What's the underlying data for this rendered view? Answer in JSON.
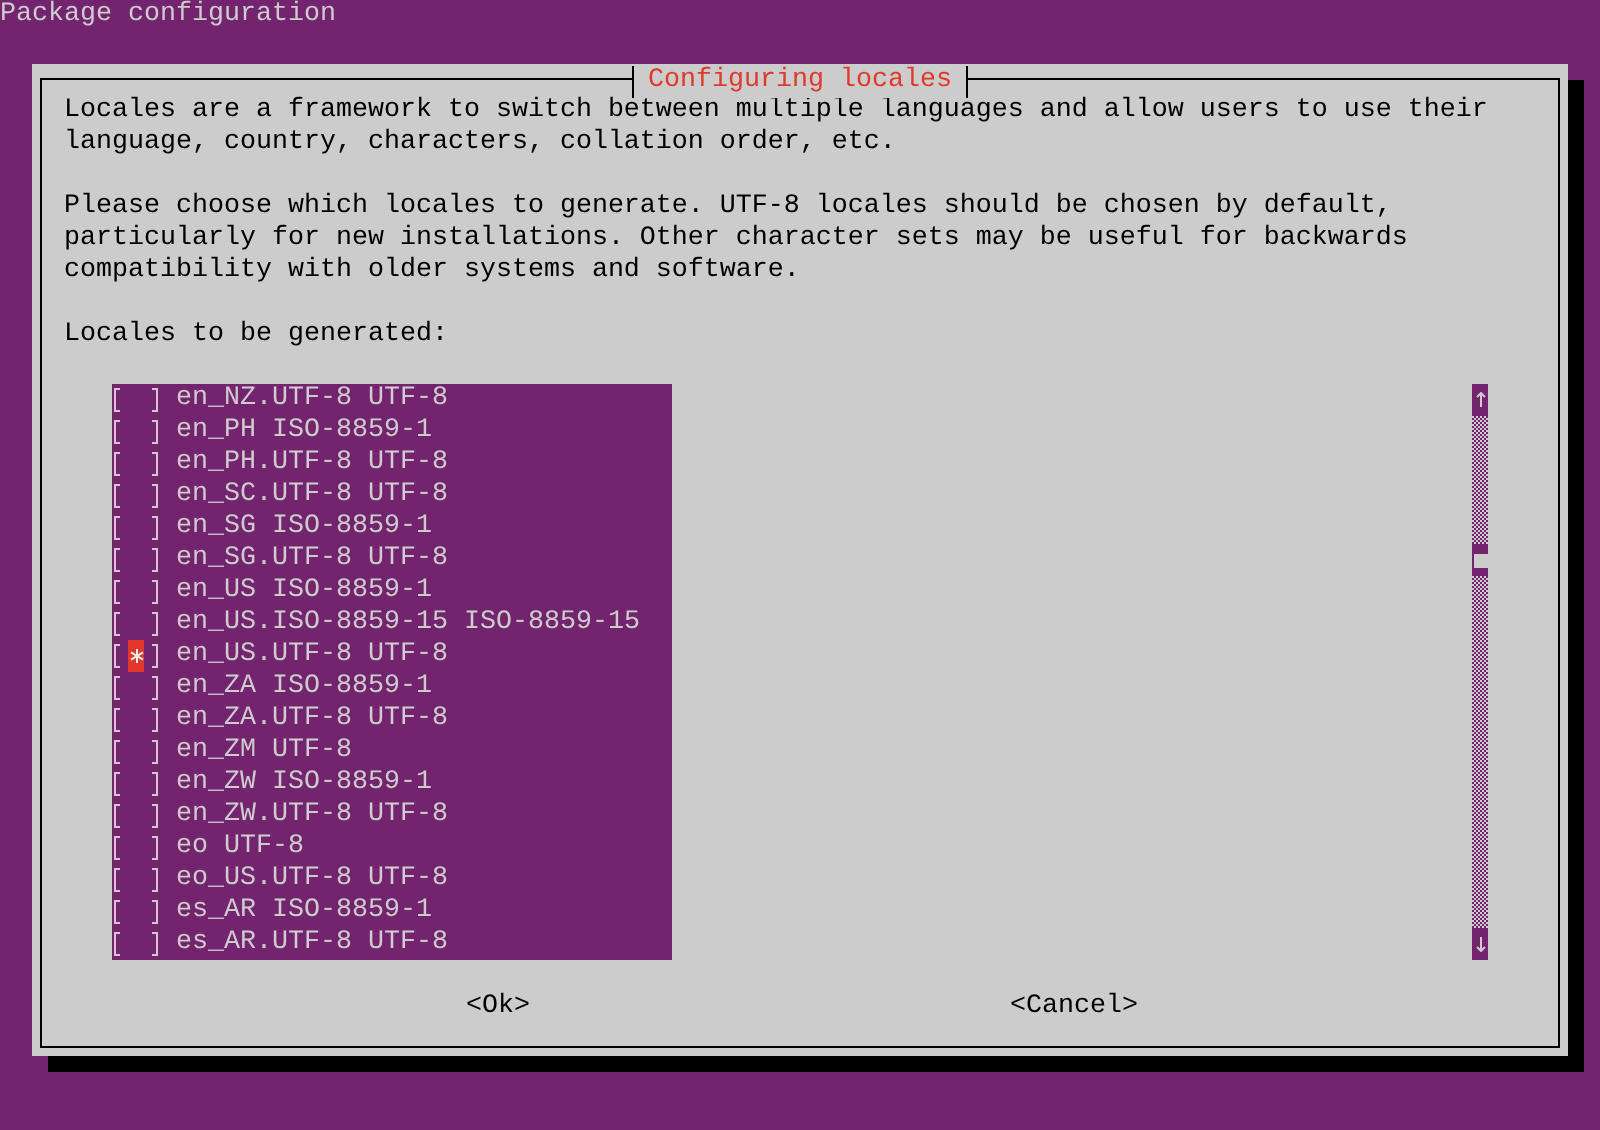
{
  "window": {
    "title": "Package configuration"
  },
  "dialog": {
    "title": "Configuring locales",
    "paragraphs": [
      "Locales are a framework to switch between multiple languages and allow users to use their language, country, characters, collation order, etc.",
      "Please choose which locales to generate. UTF-8 locales should be chosen by default, particularly for new installations. Other character sets may be useful for backwards compatibility with older systems and software."
    ],
    "list_label": "Locales to be generated:",
    "items": [
      {
        "label": "en_NZ.UTF-8 UTF-8",
        "checked": false,
        "selected": false
      },
      {
        "label": "en_PH ISO-8859-1",
        "checked": false,
        "selected": false
      },
      {
        "label": "en_PH.UTF-8 UTF-8",
        "checked": false,
        "selected": false
      },
      {
        "label": "en_SC.UTF-8 UTF-8",
        "checked": false,
        "selected": false
      },
      {
        "label": "en_SG ISO-8859-1",
        "checked": false,
        "selected": false
      },
      {
        "label": "en_SG.UTF-8 UTF-8",
        "checked": false,
        "selected": false
      },
      {
        "label": "en_US ISO-8859-1",
        "checked": false,
        "selected": false
      },
      {
        "label": "en_US.ISO-8859-15 ISO-8859-15",
        "checked": false,
        "selected": false
      },
      {
        "label": "en_US.UTF-8 UTF-8",
        "checked": true,
        "selected": true
      },
      {
        "label": "en_ZA ISO-8859-1",
        "checked": false,
        "selected": false
      },
      {
        "label": "en_ZA.UTF-8 UTF-8",
        "checked": false,
        "selected": false
      },
      {
        "label": "en_ZM UTF-8",
        "checked": false,
        "selected": false
      },
      {
        "label": "en_ZW ISO-8859-1",
        "checked": false,
        "selected": false
      },
      {
        "label": "en_ZW.UTF-8 UTF-8",
        "checked": false,
        "selected": false
      },
      {
        "label": "eo UTF-8",
        "checked": false,
        "selected": false
      },
      {
        "label": "eo_US.UTF-8 UTF-8",
        "checked": false,
        "selected": false
      },
      {
        "label": "es_AR ISO-8859-1",
        "checked": false,
        "selected": false
      },
      {
        "label": "es_AR.UTF-8 UTF-8",
        "checked": false,
        "selected": false
      }
    ],
    "buttons": [
      "<Ok>",
      "<Cancel>"
    ]
  }
}
